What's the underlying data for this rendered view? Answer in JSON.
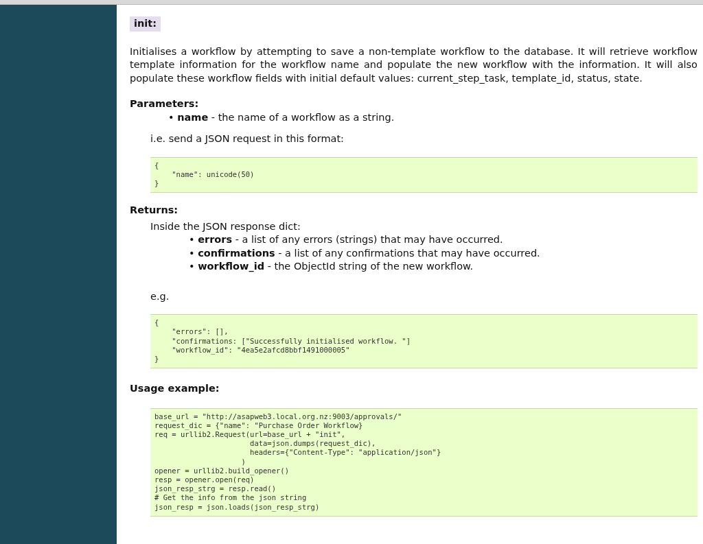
{
  "method": {
    "label": "init:"
  },
  "description": "Initialises a workflow by attempting to save a non-template workflow to the database. It will retrieve workflow template information for the workflow name and populate the new workflow with the information. It will also populate these workflow fields with initial default values: current_step_task, template_id, status, state.",
  "parameters": {
    "heading": "Parameters:",
    "items": [
      "• **name** - the name of a workflow as a string."
    ],
    "note": "i.e. send a JSON request in this format:",
    "code": [
      "{",
      "    \"name\": unicode(50)",
      "}"
    ]
  },
  "returns": {
    "heading": "Returns:",
    "intro": "Inside the JSON response dict:",
    "items": [
      "• **errors** - a list of any errors (strings) that may have occurred.",
      "• **confirmations** - a list of any confirmations that may have occurred.",
      "• **workflow_id** - the ObjectId string of the new workflow."
    ],
    "note": "e.g.",
    "code": [
      "{",
      "    \"errors\": [],",
      "    \"confirmations: [\"Successfully initialised workflow. \"]",
      "    \"workflow_id\": \"4ea5e2afcd8bbf1491000005\"",
      "}"
    ]
  },
  "usage": {
    "heading": "Usage example:",
    "code": [
      "base_url = \"http://asapweb3.local.org.nz:9003/approvals/\"",
      "request_dic = {\"name\": \"Purchase Order Workflow}",
      "req = urllib2.Request(url=base_url + \"init\",",
      "                      data=json.dumps(request_dic),",
      "                      headers={\"Content-Type\": \"application/json\"}",
      "                    )",
      "opener = urllib2.build_opener()",
      "resp = opener.open(req)",
      "json_resp_strg = resp.read()",
      "# Get the info from the json string",
      "json_resp = json.loads(json_resp_strg)"
    ]
  }
}
